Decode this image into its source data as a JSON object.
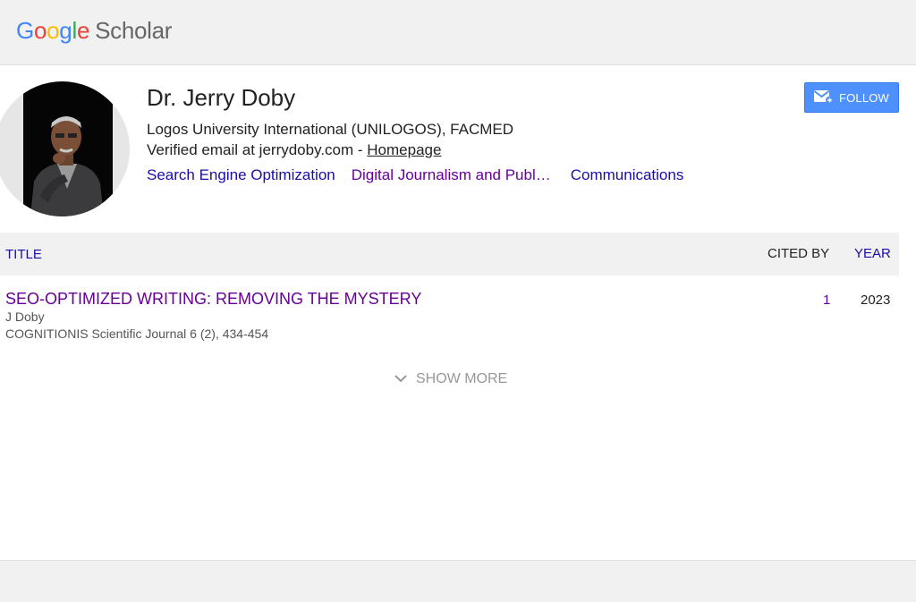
{
  "header": {
    "logo_letters": [
      "G",
      "o",
      "o",
      "g",
      "l",
      "e"
    ],
    "logo_suffix": "Scholar"
  },
  "profile": {
    "name": "Dr. Jerry Doby",
    "affiliation": "Logos University International (UNILOGOS), FACMED",
    "email_text": "Verified email at jerrydoby.com - ",
    "homepage_label": "Homepage",
    "interests": [
      "Search Engine Optimization",
      "Digital Journalism and Publ…",
      "Communications"
    ],
    "follow_label": "FOLLOW",
    "follow_icon": "mail-plus-icon"
  },
  "table": {
    "header_title": "TITLE",
    "header_cited": "CITED BY",
    "header_year": "YEAR",
    "rows": [
      {
        "title": "SEO-OPTIMIZED WRITING: REMOVING THE MYSTERY",
        "authors": "J Doby",
        "venue": "COGNITIONIS Scientific Journal 6 (2), 434-454",
        "cited_by": "1",
        "year": "2023"
      }
    ],
    "show_more_label": "SHOW MORE",
    "show_more_icon": "chevron-down-icon"
  },
  "colors": {
    "link_blue": "#1a0dab",
    "visited_purple": "#660099",
    "follow_button": "#4d90fe",
    "header_bg": "#f1f1f1"
  }
}
